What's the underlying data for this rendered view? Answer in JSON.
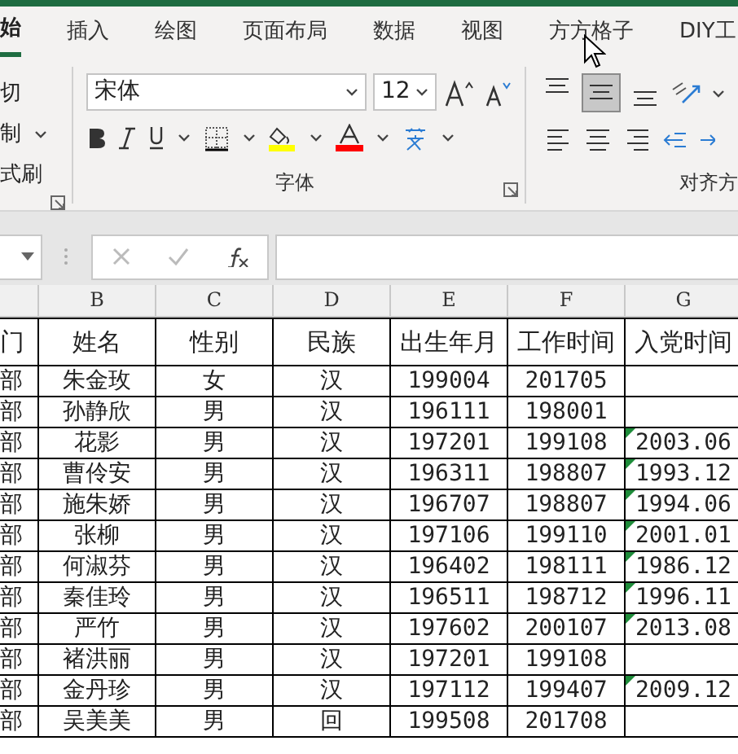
{
  "ribbon_tabs": [
    {
      "label": "始",
      "selected": true
    },
    {
      "label": "插入",
      "selected": false
    },
    {
      "label": "绘图",
      "selected": false
    },
    {
      "label": "页面布局",
      "selected": false
    },
    {
      "label": "数据",
      "selected": false
    },
    {
      "label": "视图",
      "selected": false
    },
    {
      "label": "方方格子",
      "selected": false
    },
    {
      "label": "DIY工",
      "selected": false
    }
  ],
  "clipboard": {
    "items": [
      {
        "label": "切",
        "dropdown": false
      },
      {
        "label": "制",
        "dropdown": true
      },
      {
        "label": "式刷",
        "dropdown": false
      }
    ]
  },
  "font_group": {
    "font_name": "宋体",
    "font_size": "12",
    "label": "字体"
  },
  "alignment_group": {
    "label": "对齐方",
    "vertical_align": [
      {
        "kind": "top",
        "selected": false
      },
      {
        "kind": "middle",
        "selected": true
      },
      {
        "kind": "bottom",
        "selected": false
      }
    ]
  },
  "sheet": {
    "column_letters": [
      "B",
      "C",
      "D",
      "E",
      "F",
      "G"
    ],
    "header": {
      "A": "门",
      "B": "姓名",
      "C": "性别",
      "D": "民族",
      "E": "出生年月",
      "F": "工作时间",
      "G": "入党时间"
    },
    "rows": [
      {
        "A": "部",
        "B": "朱金玫",
        "C": "女",
        "D": "汉",
        "E": "199004",
        "F": "201705",
        "flagged": false
      },
      {
        "A": "部",
        "B": "孙静欣",
        "C": "男",
        "D": "汉",
        "E": "196111",
        "F": "198001",
        "flagged": false
      },
      {
        "A": "部",
        "B": "花影",
        "C": "男",
        "D": "汉",
        "E": "197201",
        "F": "199108",
        "G": "2003.06",
        "flagged": true
      },
      {
        "A": "部",
        "B": "曹伶安",
        "C": "男",
        "D": "汉",
        "E": "196311",
        "F": "198807",
        "G": "1993.12",
        "flagged": true
      },
      {
        "A": "部",
        "B": "施朱娇",
        "C": "男",
        "D": "汉",
        "E": "196707",
        "F": "198807",
        "G": "1994.06",
        "flagged": true
      },
      {
        "A": "部",
        "B": "张柳",
        "C": "男",
        "D": "汉",
        "E": "197106",
        "F": "199110",
        "G": "2001.01",
        "flagged": true
      },
      {
        "A": "部",
        "B": "何淑芬",
        "C": "男",
        "D": "汉",
        "E": "196402",
        "F": "198111",
        "G": "1986.12",
        "flagged": true
      },
      {
        "A": "部",
        "B": "秦佳玲",
        "C": "男",
        "D": "汉",
        "E": "196511",
        "F": "198712",
        "G": "1996.11",
        "flagged": true
      },
      {
        "A": "部",
        "B": "严竹",
        "C": "男",
        "D": "汉",
        "E": "197602",
        "F": "200107",
        "G": "2013.08",
        "flagged": true
      },
      {
        "A": "部",
        "B": "褚洪丽",
        "C": "男",
        "D": "汉",
        "E": "197201",
        "F": "199108",
        "flagged": false
      },
      {
        "A": "部",
        "B": "金丹珍",
        "C": "男",
        "D": "汉",
        "E": "197112",
        "F": "199407",
        "G": "2009.12",
        "flagged": true
      },
      {
        "A": "部",
        "B": "吴美美",
        "C": "男",
        "D": "回",
        "E": "199508",
        "F": "201708",
        "flagged": false
      }
    ]
  }
}
